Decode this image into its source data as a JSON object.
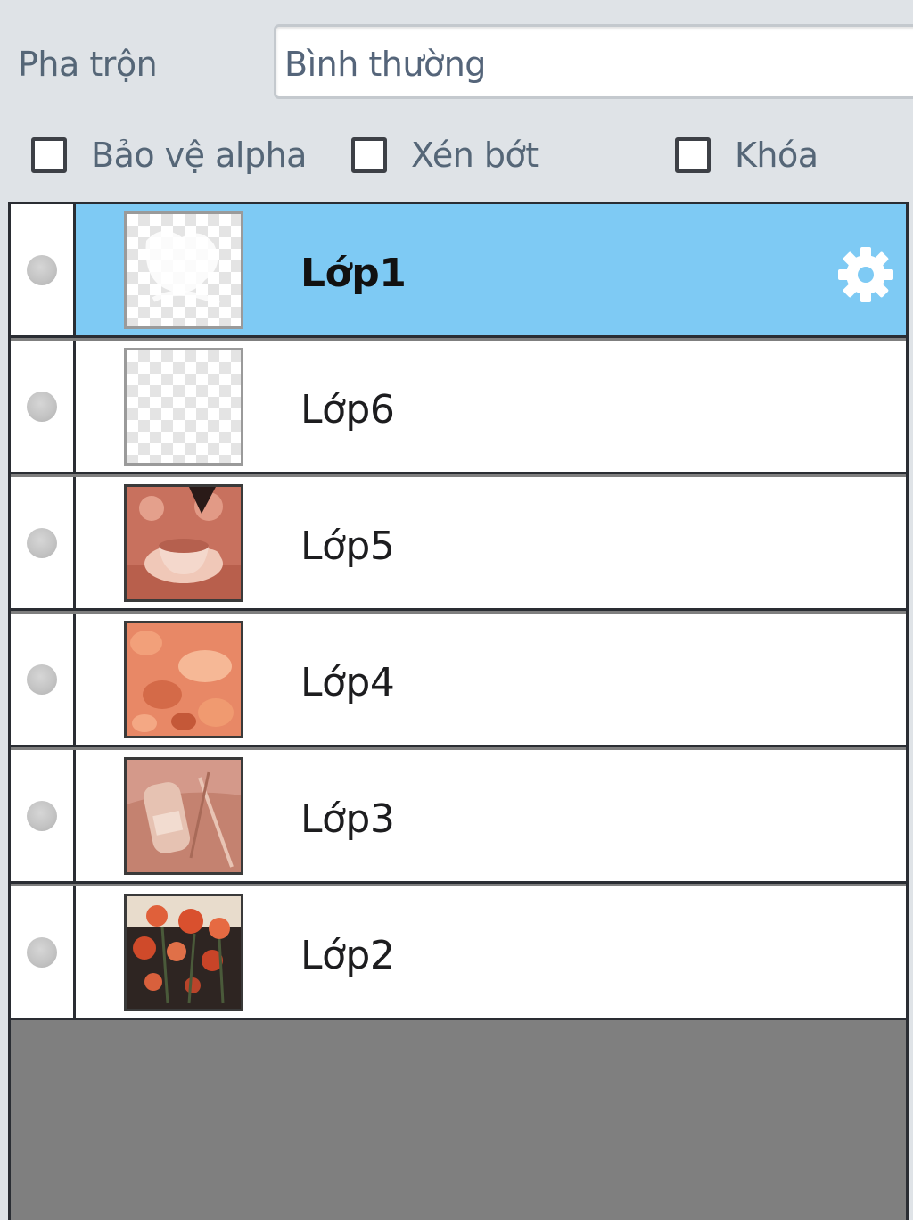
{
  "blend": {
    "label": "Pha trộn",
    "value": "Bình thường"
  },
  "options": [
    {
      "label": "Bảo vệ alpha",
      "checked": false
    },
    {
      "label": "Xén bớt",
      "checked": false
    },
    {
      "label": "Khóa",
      "checked": false
    }
  ],
  "layers": [
    {
      "name": "Lớp1",
      "selected": true,
      "thumbnail": "transparent-sketch"
    },
    {
      "name": "Lớp6",
      "selected": false,
      "thumbnail": "transparent"
    },
    {
      "name": "Lớp5",
      "selected": false,
      "thumbnail": "coffee-cup-photo"
    },
    {
      "name": "Lớp4",
      "selected": false,
      "thumbnail": "peach-flowers-photo"
    },
    {
      "name": "Lớp3",
      "selected": false,
      "thumbnail": "perfume-bottle-photo"
    },
    {
      "name": "Lớp2",
      "selected": false,
      "thumbnail": "red-roses-photo"
    }
  ],
  "icons": {
    "visibility": "visibility-dot-icon",
    "settings": "gear-icon"
  },
  "colors": {
    "selected_row": "#7ecaf4",
    "panel_bg": "#dfe3e7",
    "empty_area": "#7f7f7f"
  }
}
